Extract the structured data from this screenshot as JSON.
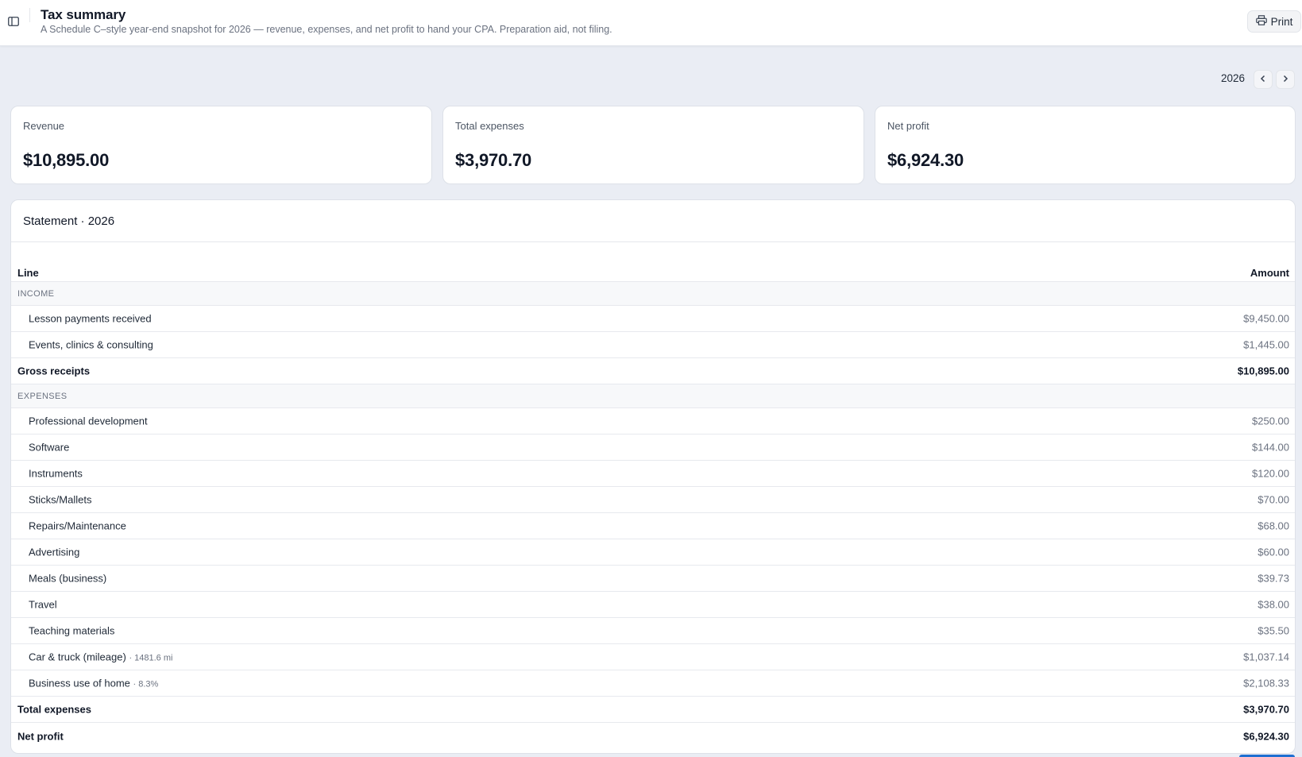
{
  "header": {
    "title": "Tax summary",
    "subtitle": "A Schedule C–style year-end snapshot for 2026 — revenue, expenses, and net profit to hand your CPA. Preparation aid, not filing.",
    "print_label": "Print"
  },
  "year_selector": {
    "year": "2026"
  },
  "cards": [
    {
      "label": "Revenue",
      "value": "$10,895.00"
    },
    {
      "label": "Total expenses",
      "value": "$3,970.70"
    },
    {
      "label": "Net profit",
      "value": "$6,924.30"
    }
  ],
  "statement": {
    "title": "Statement · 2026",
    "columns": {
      "line": "Line",
      "amount": "Amount"
    },
    "income_section": "INCOME",
    "income_items": [
      {
        "line": "Lesson payments received",
        "amount": "$9,450.00"
      },
      {
        "line": "Events, clinics & consulting",
        "amount": "$1,445.00"
      }
    ],
    "gross_receipts": {
      "line": "Gross receipts",
      "amount": "$10,895.00"
    },
    "expenses_section": "EXPENSES",
    "expense_items": [
      {
        "line": "Professional development",
        "amount": "$250.00"
      },
      {
        "line": "Software",
        "amount": "$144.00"
      },
      {
        "line": "Instruments",
        "amount": "$120.00"
      },
      {
        "line": "Sticks/Mallets",
        "amount": "$70.00"
      },
      {
        "line": "Repairs/Maintenance",
        "amount": "$68.00"
      },
      {
        "line": "Advertising",
        "amount": "$60.00"
      },
      {
        "line": "Meals (business)",
        "amount": "$39.73"
      },
      {
        "line": "Travel",
        "amount": "$38.00"
      },
      {
        "line": "Teaching materials",
        "amount": "$35.50"
      },
      {
        "line": "Car & truck (mileage)",
        "note": "· 1481.6 mi",
        "amount": "$1,037.14"
      },
      {
        "line": "Business use of home",
        "note": "· 8.3%",
        "amount": "$2,108.33"
      }
    ],
    "total_expenses": {
      "line": "Total expenses",
      "amount": "$3,970.70"
    },
    "net_profit": {
      "line": "Net profit",
      "amount": "$6,924.30"
    }
  },
  "colors": {
    "background": "#eaedf4",
    "card": "#ffffff",
    "text_primary": "#111827",
    "text_muted": "#6b7280",
    "accent": "#1f6fd1"
  }
}
